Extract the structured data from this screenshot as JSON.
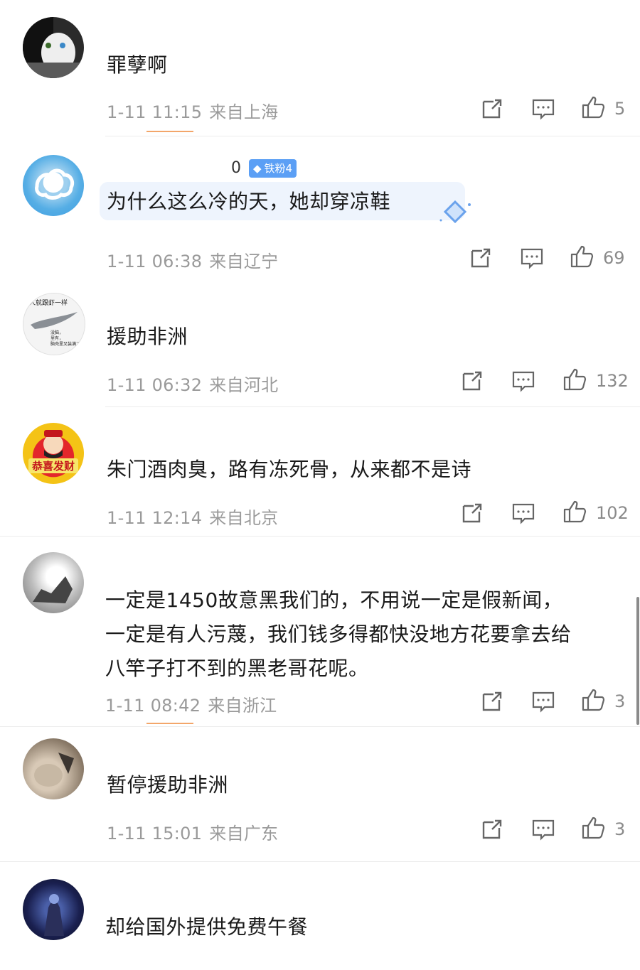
{
  "comments": [
    {
      "username": "",
      "content": "罪孽啊",
      "time": "1-11 11:15",
      "location": "来自上海",
      "likes": "5"
    },
    {
      "username": "0",
      "badge": "铁粉4",
      "content": "为什么这么冷的天，她却穿凉鞋",
      "time": "1-11 06:38",
      "location": "来自辽宁",
      "likes": "69"
    },
    {
      "username": "",
      "avatar_text": [
        "人就跟虾一样",
        "没脑，",
        "里有，",
        "脑壳里又装满了屎"
      ],
      "content": "援助非洲",
      "time": "1-11 06:32",
      "location": "来自河北",
      "likes": "132"
    },
    {
      "username": "",
      "avatar_text": "恭喜发财",
      "content": "朱门酒肉臭，路有冻死骨，从来都不是诗",
      "time": "1-11 12:14",
      "location": "来自北京",
      "likes": "102"
    },
    {
      "username": "",
      "content_lines": [
        "一定是1450故意黑我们的，不用说一定是假新闻，",
        "一定是有人污蔑，我们钱多得都快没地方花要拿去给",
        "八竿子打不到的黑老哥花呢。"
      ],
      "time": "1-11 08:42",
      "location": "来自浙江",
      "likes": "3"
    },
    {
      "username": "",
      "content": "暂停援助非洲",
      "time": "1-11 15:01",
      "location": "来自广东",
      "likes": "3"
    },
    {
      "username": "",
      "content": "却给国外提供免费午餐"
    }
  ],
  "colors": {
    "meta_text": "#9a9a9a",
    "accent": "#f3a66a",
    "badge": "#5b9ff5",
    "bubble": "#eef4fd"
  },
  "icons": [
    "share-icon",
    "comment-icon",
    "like-icon"
  ]
}
